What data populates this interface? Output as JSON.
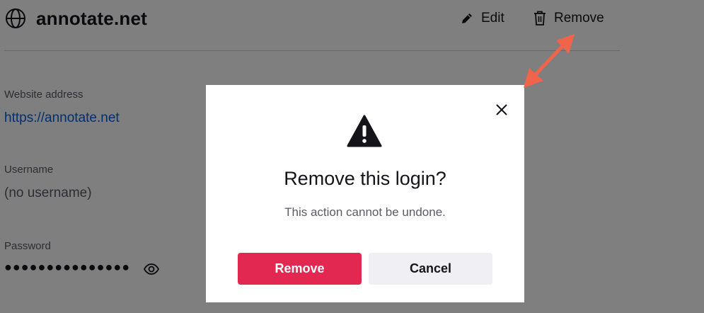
{
  "header": {
    "site_title": "annotate.net",
    "edit_label": "Edit",
    "remove_label": "Remove"
  },
  "fields": {
    "website_label": "Website address",
    "website_value": "https://annotate.net",
    "username_label": "Username",
    "username_value": "(no username)",
    "password_label": "Password",
    "password_value": "●●●●●●●●●●●●●●●"
  },
  "dialog": {
    "title": "Remove this login?",
    "message": "This action cannot be undone.",
    "confirm_label": "Remove",
    "cancel_label": "Cancel"
  },
  "icons": {
    "header": "globe-icon",
    "edit": "pencil-icon",
    "remove": "trash-icon",
    "password_toggle": "eye-icon",
    "dialog_close": "close-icon",
    "dialog_alert": "warning-icon"
  },
  "colors": {
    "primary_button": "#e22850",
    "secondary_button": "#f0f0f4",
    "link": "#0061e0",
    "annotation_arrow": "#f0644b"
  }
}
